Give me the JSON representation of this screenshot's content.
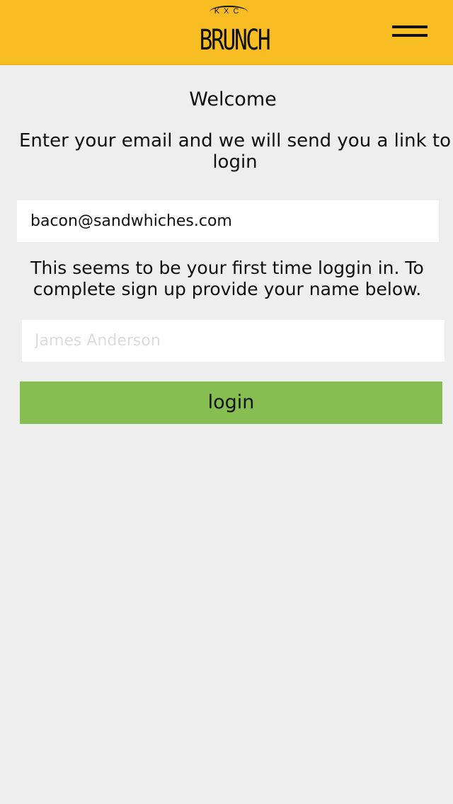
{
  "header": {
    "brand_sub": "KXC",
    "brand_name": "BRUNCH",
    "menu_icon": "hamburger-menu-icon",
    "background_color": "#f9bd24"
  },
  "main": {
    "welcome": "Welcome",
    "instruction": "Enter your email and we will send you a link to login",
    "email_value": "bacon@sandwhiches.com",
    "first_time_message": "This seems to be your first time  loggin in. To complete sign up provide your name below.",
    "name_placeholder": "James Anderson",
    "login_label": "login",
    "login_button_color": "#86be51"
  }
}
